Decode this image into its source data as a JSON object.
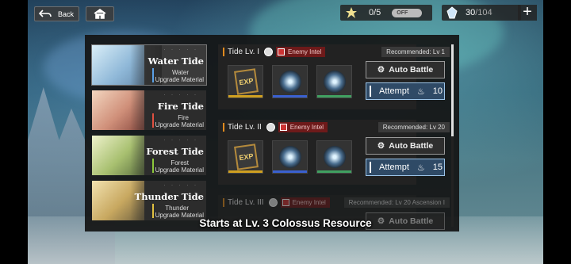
{
  "topbar": {
    "back_label": "Back",
    "tickets": "0/5",
    "toggle_label": "OFF",
    "stamina_current": "30",
    "stamina_max": "/104"
  },
  "tides": [
    {
      "name": "Water Tide",
      "sub1": "Water",
      "sub2": "Upgrade Material",
      "color": "#5aa0e6"
    },
    {
      "name": "Fire Tide",
      "sub1": "Fire",
      "sub2": "Upgrade Material",
      "color": "#e05040"
    },
    {
      "name": "Forest Tide",
      "sub1": "Forest",
      "sub2": "Upgrade Material",
      "color": "#8cc83c"
    },
    {
      "name": "Thunder Tide",
      "sub1": "Thunder",
      "sub2": "Upgrade Material",
      "color": "#e0c040"
    }
  ],
  "tide_dots": "· · · · ·",
  "stages": [
    {
      "title": "Tide Lv. I",
      "intel": "Enemy Intel",
      "recommend": "Recommended: Lv 1",
      "auto": "Auto Battle",
      "attempt": "Attempt",
      "cost": "10"
    },
    {
      "title": "Tide Lv. II",
      "intel": "Enemy Intel",
      "recommend": "Recommended: Lv 20",
      "auto": "Auto Battle",
      "attempt": "Attempt",
      "cost": "15"
    },
    {
      "title": "Tide Lv. III",
      "intel": "Enemy Intel",
      "recommend": "Recommended: Lv 20 Ascension I",
      "auto": "Auto Battle"
    }
  ],
  "reward_book_label": "EXP",
  "subtitle": "Starts at Lv. 3 Colossus Resource"
}
